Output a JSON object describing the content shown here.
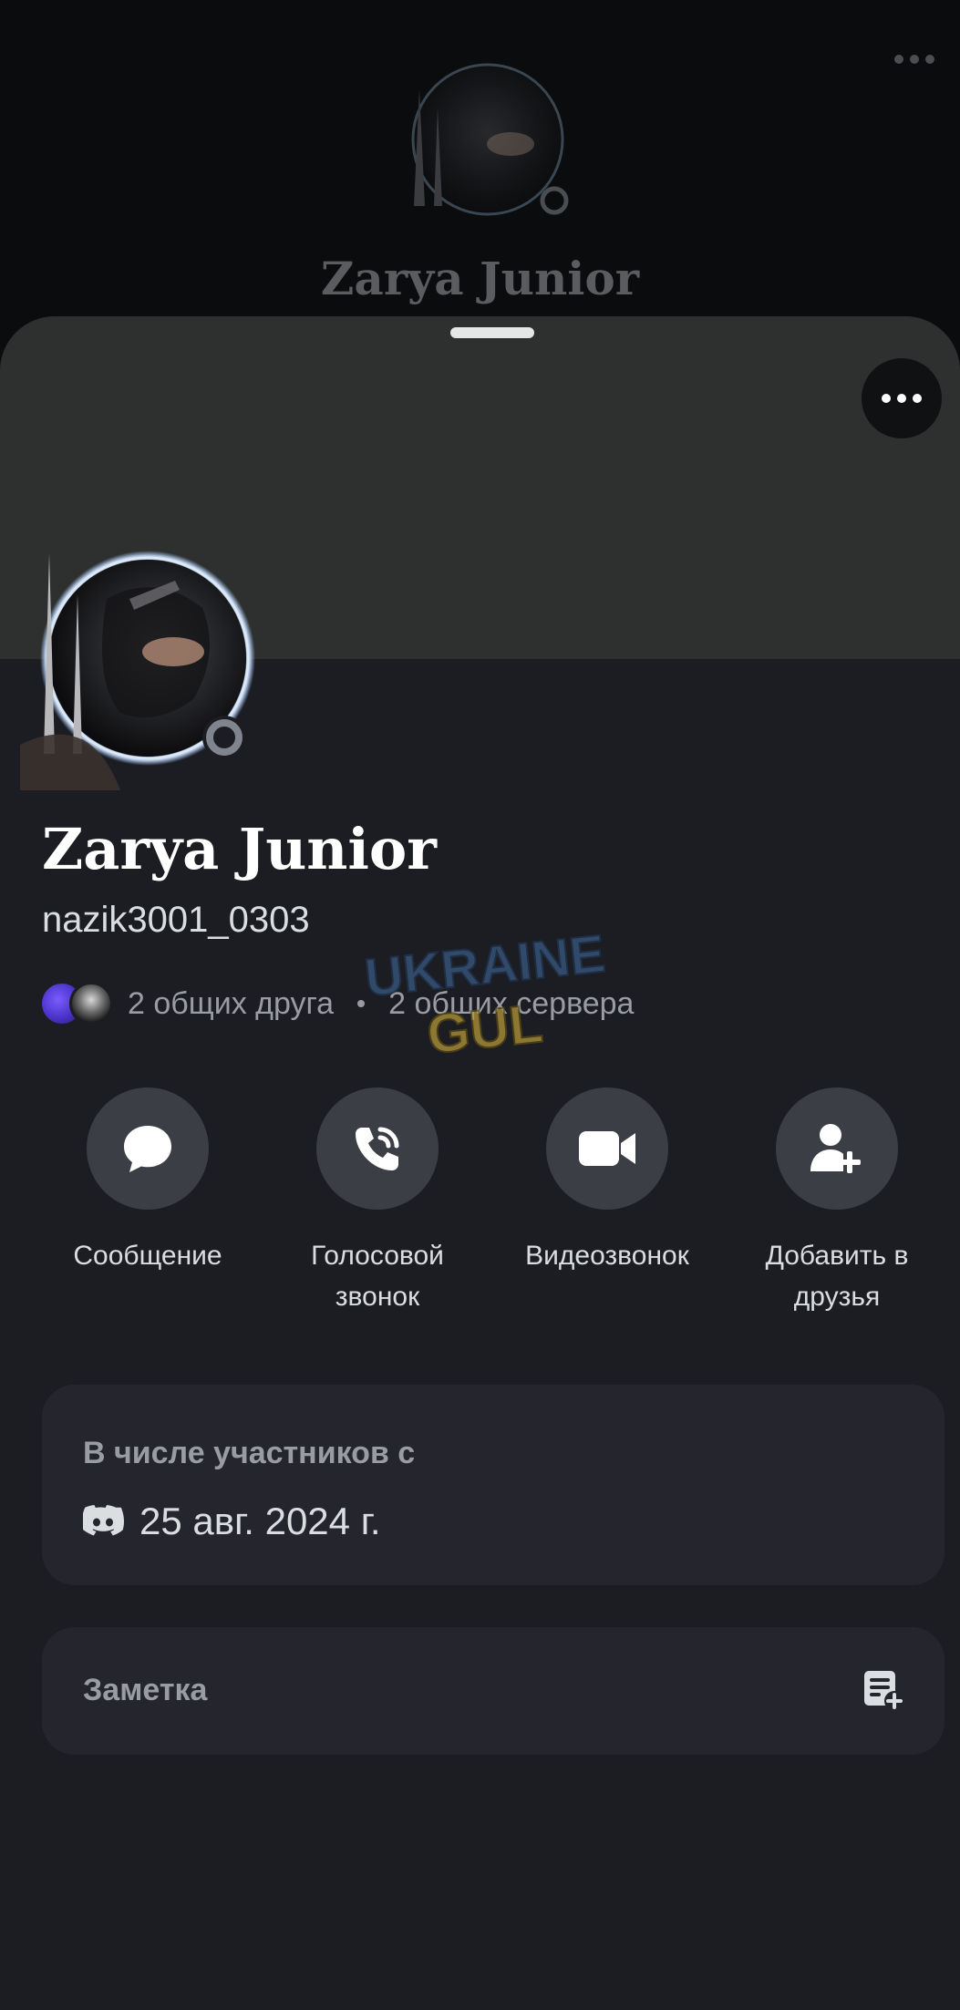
{
  "background": {
    "title": "Zarya Junior",
    "menu_icon": "more-horizontal-icon"
  },
  "profile": {
    "display_name": "Zarya Junior",
    "username": "nazik3001_0303",
    "mutual_friends": "2 общих друга",
    "mutual_servers": "2 общих сервера",
    "status": "offline",
    "banner_color": "#2d302e"
  },
  "watermark": {
    "line1": "UKRAINE",
    "line2": "GUL"
  },
  "actions": [
    {
      "label": "Сообщение",
      "icon": "chat-bubble-icon"
    },
    {
      "label": "Голосовой звонок",
      "icon": "phone-call-icon"
    },
    {
      "label": "Видеозвонок",
      "icon": "video-camera-icon"
    },
    {
      "label": "Добавить в друзья",
      "icon": "add-friend-icon"
    }
  ],
  "member_since": {
    "title": "В числе участников с",
    "date": "25 авг. 2024 г.",
    "icon": "discord-icon"
  },
  "note": {
    "label": "Заметка",
    "icon": "note-add-icon"
  },
  "colors": {
    "sheet_bg": "#1c1d22",
    "card_bg": "#25262d",
    "button_bg": "#3c3e45",
    "status_offline": "#80848e"
  }
}
